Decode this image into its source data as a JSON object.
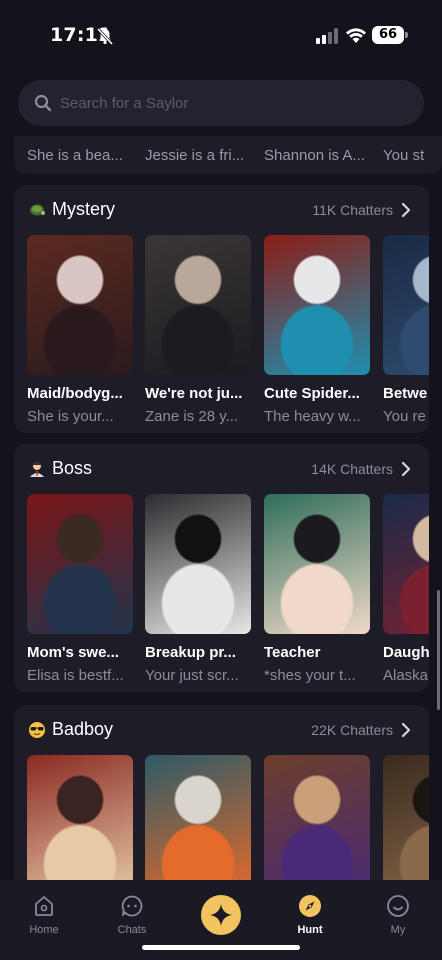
{
  "status_bar": {
    "time": "17:11",
    "battery": "66"
  },
  "search": {
    "placeholder": "Search for a Saylor"
  },
  "previous_section": {
    "descriptions": [
      "She is a bea...",
      "Jessie is a fri...",
      "Shannon is A...",
      "You st"
    ]
  },
  "sections": [
    {
      "title": "Mystery",
      "emoji_icon": "turtle-icon",
      "chatters": "11K Chatters",
      "cards": [
        {
          "name": "Maid/bodyg...",
          "desc": "She is your...",
          "colors": [
            "#5c2a20",
            "#2a1a1e",
            "#d9c6c2"
          ]
        },
        {
          "name": "We're not ju...",
          "desc": "Zane is 28 y...",
          "colors": [
            "#3a3538",
            "#1c1b1f",
            "#b9a89a"
          ]
        },
        {
          "name": "Cute Spider...",
          "desc": "The heavy w...",
          "colors": [
            "#8b1d16",
            "#1f8fb0",
            "#e7e7ea"
          ]
        },
        {
          "name": "Betwe",
          "desc": "You re",
          "colors": [
            "#1a2a44",
            "#2f4c70",
            "#a7b7cc"
          ]
        }
      ]
    },
    {
      "title": "Boss",
      "emoji_icon": "office-worker-icon",
      "chatters": "14K Chatters",
      "cards": [
        {
          "name": "Mom's swe...",
          "desc": "Elisa is bestf...",
          "colors": [
            "#7a1616",
            "#24344d",
            "#3b2a22"
          ]
        },
        {
          "name": "Breakup pr...",
          "desc": "Your just scr...",
          "colors": [
            "#2c2c30",
            "#e7e7e7",
            "#111114"
          ]
        },
        {
          "name": "Teacher",
          "desc": "*shes your t...",
          "colors": [
            "#2f6e5a",
            "#f0d9c8",
            "#1a1a1f"
          ]
        },
        {
          "name": "Daugh",
          "desc": "Alaska",
          "colors": [
            "#1b2b4a",
            "#7a2030",
            "#d3b9a0"
          ]
        }
      ]
    },
    {
      "title": "Badboy",
      "emoji_icon": "sunglasses-face-icon",
      "chatters": "22K Chatters",
      "cards": [
        {
          "name": "",
          "desc": "",
          "colors": [
            "#8a2a22",
            "#e7c9a6",
            "#3a2320"
          ]
        },
        {
          "name": "",
          "desc": "",
          "colors": [
            "#2e5a66",
            "#e56b2c",
            "#d9d4cc"
          ]
        },
        {
          "name": "",
          "desc": "",
          "colors": [
            "#6b3e2a",
            "#4b2a77",
            "#caa07a"
          ]
        },
        {
          "name": "",
          "desc": "",
          "colors": [
            "#3a2a1e",
            "#8a6a4a",
            "#1a1412"
          ]
        }
      ]
    }
  ],
  "tabs": [
    {
      "label": "Home",
      "icon": "home-icon"
    },
    {
      "label": "Chats",
      "icon": "chat-icon"
    },
    {
      "label": "",
      "icon": "sparkle-icon"
    },
    {
      "label": "Hunt",
      "icon": "compass-icon"
    },
    {
      "label": "My",
      "icon": "smiley-icon"
    }
  ],
  "colors": {
    "background": "#14131c",
    "card_bg": "#1d1c27",
    "accent": "#f2c35e"
  }
}
